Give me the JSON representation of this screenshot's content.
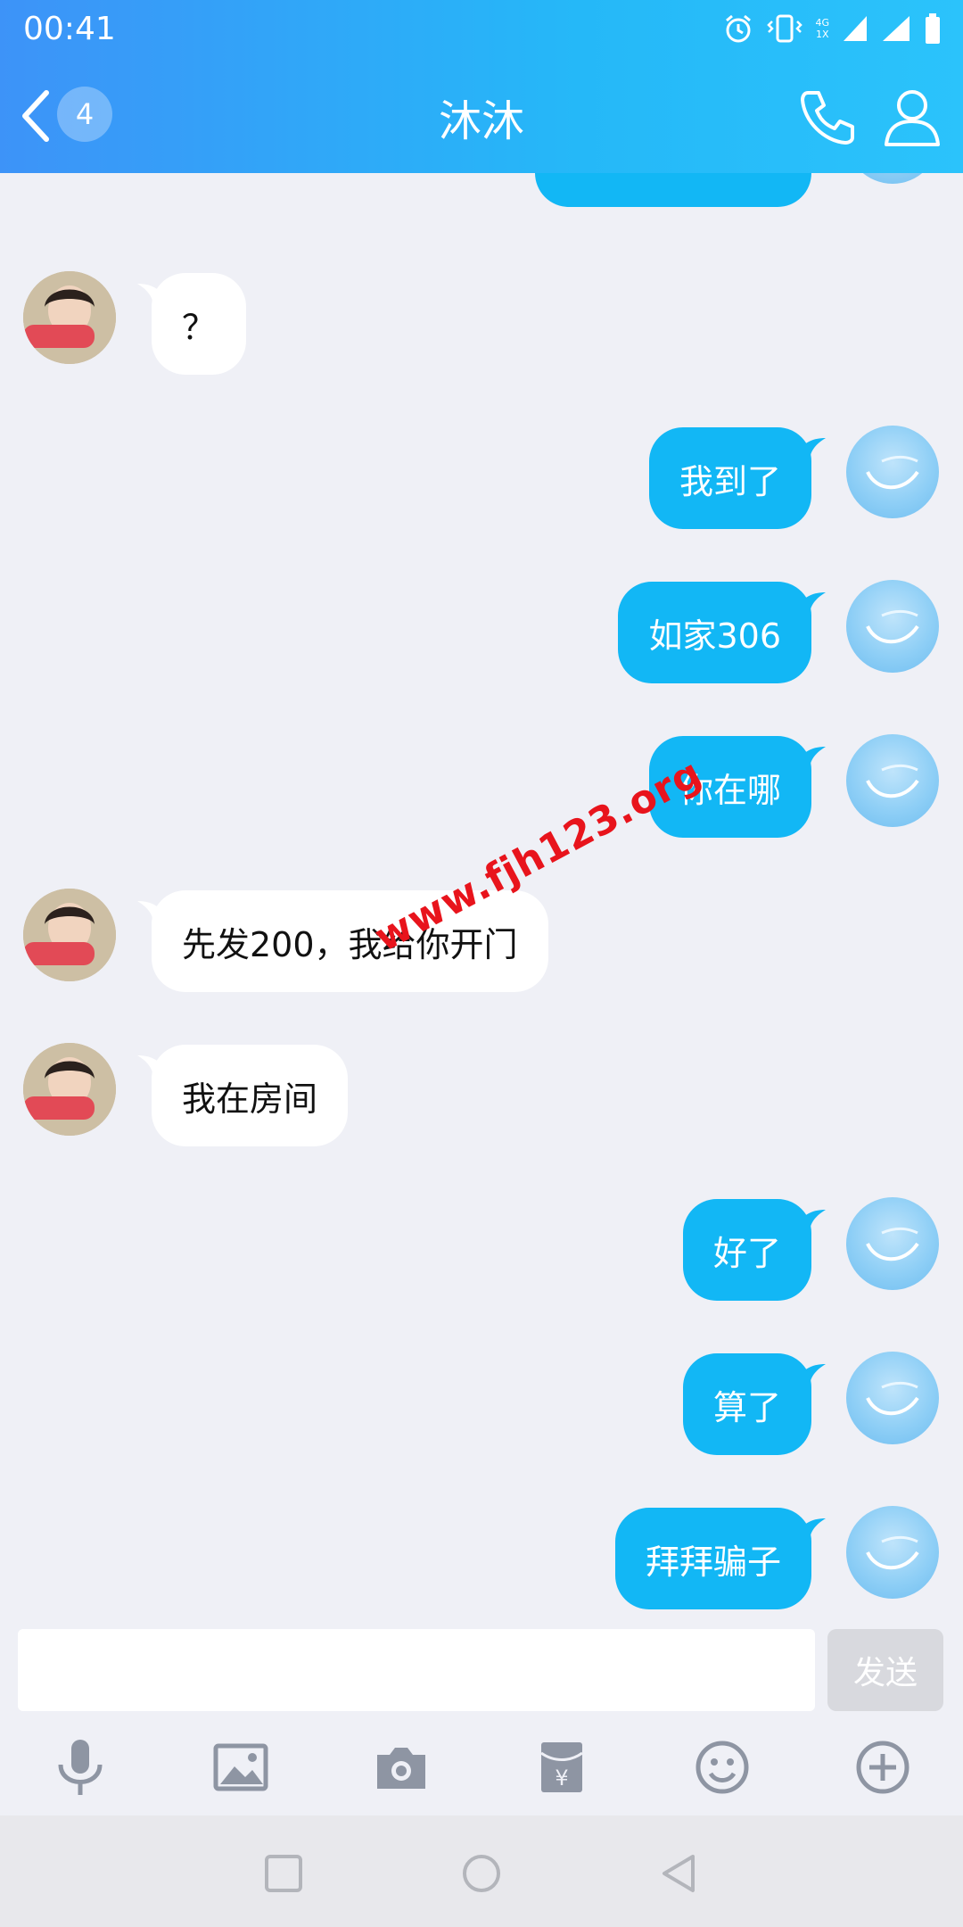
{
  "status": {
    "time": "00:41",
    "net": "4G",
    "net_sub": "1X"
  },
  "header": {
    "badge": "4",
    "title": "沐沐"
  },
  "messages": [
    {
      "side": "me",
      "text": "",
      "partial": true
    },
    {
      "side": "them",
      "text": "？"
    },
    {
      "side": "me",
      "text": "我到了"
    },
    {
      "side": "me",
      "text": "如家306"
    },
    {
      "side": "me",
      "text": "你在哪"
    },
    {
      "side": "them",
      "text": "先发200，我给你开门"
    },
    {
      "side": "them",
      "text": "我在房间"
    },
    {
      "side": "me",
      "text": "好了"
    },
    {
      "side": "me",
      "text": "算了"
    },
    {
      "side": "me",
      "text": "拜拜骗子"
    }
  ],
  "watermark": "www.fjh123.org",
  "input": {
    "placeholder": "",
    "send_label": "发送"
  },
  "toolbar": [
    "microphone-icon",
    "image-icon",
    "camera-icon",
    "red-packet-icon",
    "emoji-icon",
    "plus-icon"
  ],
  "nav": [
    "recent-apps-icon",
    "home-icon",
    "back-icon"
  ],
  "colors": {
    "header_start": "#3d93f8",
    "header_end": "#2bc3fb",
    "my_bubble": "#12b7f5",
    "their_bubble": "#ffffff",
    "background": "#eff0f6",
    "watermark": "#e8141c"
  }
}
